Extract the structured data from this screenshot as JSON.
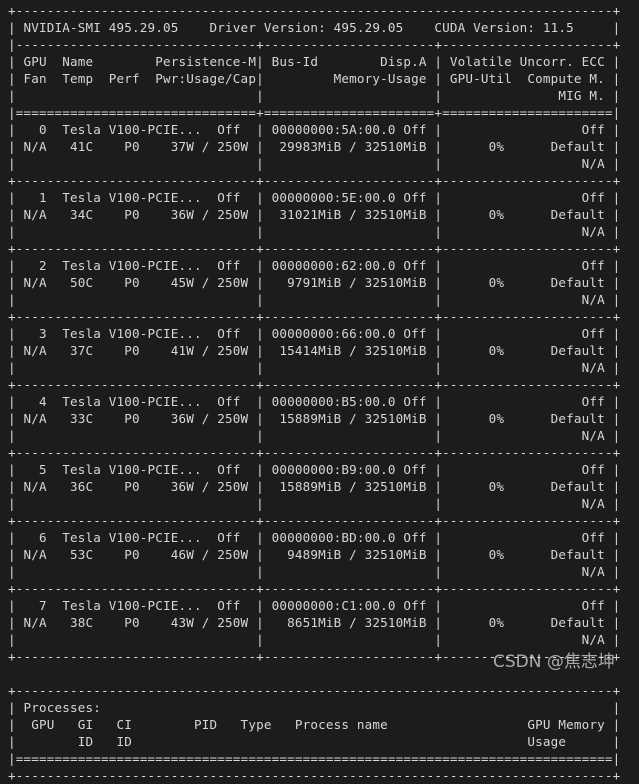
{
  "terminal": {
    "program": "nvidia-smi",
    "background_color": "#1c1c1c",
    "foreground_color": "#d6d6d6",
    "columns": 79
  },
  "header": {
    "smi_label": "NVIDIA-SMI",
    "smi_version": "495.29.05",
    "driver_label": "Driver Version:",
    "driver_version": "495.29.05",
    "cuda_label": "CUDA Version:",
    "cuda_version": "11.5"
  },
  "gpu_table": {
    "columns_line1": [
      "GPU",
      "Name",
      "Persistence-M",
      "Bus-Id",
      "Disp.A",
      "Volatile Uncorr. ECC"
    ],
    "columns_line2": [
      "Fan",
      "Temp",
      "Perf",
      "Pwr:Usage/Cap",
      "Memory-Usage",
      "GPU-Util  Compute M."
    ],
    "columns_line3": [
      "MIG M."
    ],
    "rows": [
      {
        "index": "0",
        "name": "Tesla V100-PCIE...",
        "persistence": "Off",
        "bus_id": "00000000:5A:00.0",
        "disp_a": "Off",
        "ecc": "Off",
        "fan": "N/A",
        "temp": "41C",
        "perf": "P0",
        "pwr": "37W / 250W",
        "memory": "29983MiB / 32510MiB",
        "util": "0%",
        "compute_mode": "Default",
        "mig": "N/A"
      },
      {
        "index": "1",
        "name": "Tesla V100-PCIE...",
        "persistence": "Off",
        "bus_id": "00000000:5E:00.0",
        "disp_a": "Off",
        "ecc": "Off",
        "fan": "N/A",
        "temp": "34C",
        "perf": "P0",
        "pwr": "36W / 250W",
        "memory": "31021MiB / 32510MiB",
        "util": "0%",
        "compute_mode": "Default",
        "mig": "N/A"
      },
      {
        "index": "2",
        "name": "Tesla V100-PCIE...",
        "persistence": "Off",
        "bus_id": "00000000:62:00.0",
        "disp_a": "Off",
        "ecc": "Off",
        "fan": "N/A",
        "temp": "50C",
        "perf": "P0",
        "pwr": "45W / 250W",
        "memory": "9791MiB / 32510MiB",
        "util": "0%",
        "compute_mode": "Default",
        "mig": "N/A"
      },
      {
        "index": "3",
        "name": "Tesla V100-PCIE...",
        "persistence": "Off",
        "bus_id": "00000000:66:00.0",
        "disp_a": "Off",
        "ecc": "Off",
        "fan": "N/A",
        "temp": "37C",
        "perf": "P0",
        "pwr": "41W / 250W",
        "memory": "15414MiB / 32510MiB",
        "util": "0%",
        "compute_mode": "Default",
        "mig": "N/A"
      },
      {
        "index": "4",
        "name": "Tesla V100-PCIE...",
        "persistence": "Off",
        "bus_id": "00000000:B5:00.0",
        "disp_a": "Off",
        "ecc": "Off",
        "fan": "N/A",
        "temp": "33C",
        "perf": "P0",
        "pwr": "36W / 250W",
        "memory": "15889MiB / 32510MiB",
        "util": "0%",
        "compute_mode": "Default",
        "mig": "N/A"
      },
      {
        "index": "5",
        "name": "Tesla V100-PCIE...",
        "persistence": "Off",
        "bus_id": "00000000:B9:00.0",
        "disp_a": "Off",
        "ecc": "Off",
        "fan": "N/A",
        "temp": "36C",
        "perf": "P0",
        "pwr": "36W / 250W",
        "memory": "15889MiB / 32510MiB",
        "util": "0%",
        "compute_mode": "Default",
        "mig": "N/A"
      },
      {
        "index": "6",
        "name": "Tesla V100-PCIE...",
        "persistence": "Off",
        "bus_id": "00000000:BD:00.0",
        "disp_a": "Off",
        "ecc": "Off",
        "fan": "N/A",
        "temp": "53C",
        "perf": "P0",
        "pwr": "46W / 250W",
        "memory": "9489MiB / 32510MiB",
        "util": "0%",
        "compute_mode": "Default",
        "mig": "N/A"
      },
      {
        "index": "7",
        "name": "Tesla V100-PCIE...",
        "persistence": "Off",
        "bus_id": "00000000:C1:00.0",
        "disp_a": "Off",
        "ecc": "Off",
        "fan": "N/A",
        "temp": "38C",
        "perf": "P0",
        "pwr": "43W / 250W",
        "memory": "8651MiB / 32510MiB",
        "util": "0%",
        "compute_mode": "Default",
        "mig": "N/A"
      }
    ]
  },
  "processes_table": {
    "title": "Processes:",
    "columns_line1": [
      "GPU",
      "GI",
      "CI",
      "PID",
      "Type",
      "Process name",
      "GPU Memory"
    ],
    "columns_line2": [
      "ID",
      "ID",
      "Usage"
    ],
    "rows": []
  },
  "watermark": {
    "text": "CSDN @焦志坤"
  },
  "rendered_text": "+-----------------------------------------------------------------------------+\n| NVIDIA-SMI 495.29.05    Driver Version: 495.29.05    CUDA Version: 11.5     |\n|-------------------------------+----------------------+----------------------+\n| GPU  Name        Persistence-M| Bus-Id        Disp.A | Volatile Uncorr. ECC |\n| Fan  Temp  Perf  Pwr:Usage/Cap|         Memory-Usage | GPU-Util  Compute M. |\n|                               |                      |               MIG M. |\n|===============================+======================+======================|\n|   0  Tesla V100-PCIE...  Off  | 00000000:5A:00.0 Off |                  Off |\n| N/A   41C    P0    37W / 250W |  29983MiB / 32510MiB |      0%      Default |\n|                               |                      |                  N/A |\n+-------------------------------+----------------------+----------------------+\n|   1  Tesla V100-PCIE...  Off  | 00000000:5E:00.0 Off |                  Off |\n| N/A   34C    P0    36W / 250W |  31021MiB / 32510MiB |      0%      Default |\n|                               |                      |                  N/A |\n+-------------------------------+----------------------+----------------------+\n|   2  Tesla V100-PCIE...  Off  | 00000000:62:00.0 Off |                  Off |\n| N/A   50C    P0    45W / 250W |   9791MiB / 32510MiB |      0%      Default |\n|                               |                      |                  N/A |\n+-------------------------------+----------------------+----------------------+\n|   3  Tesla V100-PCIE...  Off  | 00000000:66:00.0 Off |                  Off |\n| N/A   37C    P0    41W / 250W |  15414MiB / 32510MiB |      0%      Default |\n|                               |                      |                  N/A |\n+-------------------------------+----------------------+----------------------+\n|   4  Tesla V100-PCIE...  Off  | 00000000:B5:00.0 Off |                  Off |\n| N/A   33C    P0    36W / 250W |  15889MiB / 32510MiB |      0%      Default |\n|                               |                      |                  N/A |\n+-------------------------------+----------------------+----------------------+\n|   5  Tesla V100-PCIE...  Off  | 00000000:B9:00.0 Off |                  Off |\n| N/A   36C    P0    36W / 250W |  15889MiB / 32510MiB |      0%      Default |\n|                               |                      |                  N/A |\n+-------------------------------+----------------------+----------------------+\n|   6  Tesla V100-PCIE...  Off  | 00000000:BD:00.0 Off |                  Off |\n| N/A   53C    P0    46W / 250W |   9489MiB / 32510MiB |      0%      Default |\n|                               |                      |                  N/A |\n+-------------------------------+----------------------+----------------------+\n|   7  Tesla V100-PCIE...  Off  | 00000000:C1:00.0 Off |                  Off |\n| N/A   38C    P0    43W / 250W |   8651MiB / 32510MiB |      0%      Default |\n|                               |                      |                  N/A |\n+-------------------------------+----------------------+----------------------+\n                                                                               \n+-----------------------------------------------------------------------------+\n| Processes:                                                                  |\n|  GPU   GI   CI        PID   Type   Process name                  GPU Memory |\n|        ID   ID                                                   Usage      |\n|=============================================================================|\n+-----------------------------------------------------------------------------+"
}
